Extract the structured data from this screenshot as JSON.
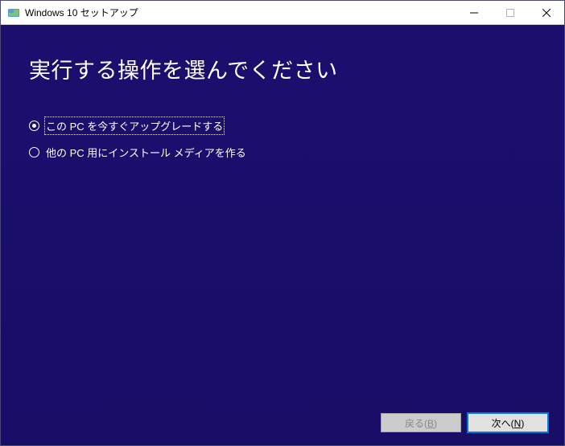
{
  "window": {
    "title": "Windows 10 セットアップ"
  },
  "main": {
    "heading": "実行する操作を選んでください",
    "options": [
      {
        "label": "この PC を今すぐアップグレードする",
        "selected": true
      },
      {
        "label": "他の PC 用にインストール メディアを作る",
        "selected": false
      }
    ]
  },
  "footer": {
    "back_label": "戻る(B)",
    "next_label": "次へ(N)"
  }
}
